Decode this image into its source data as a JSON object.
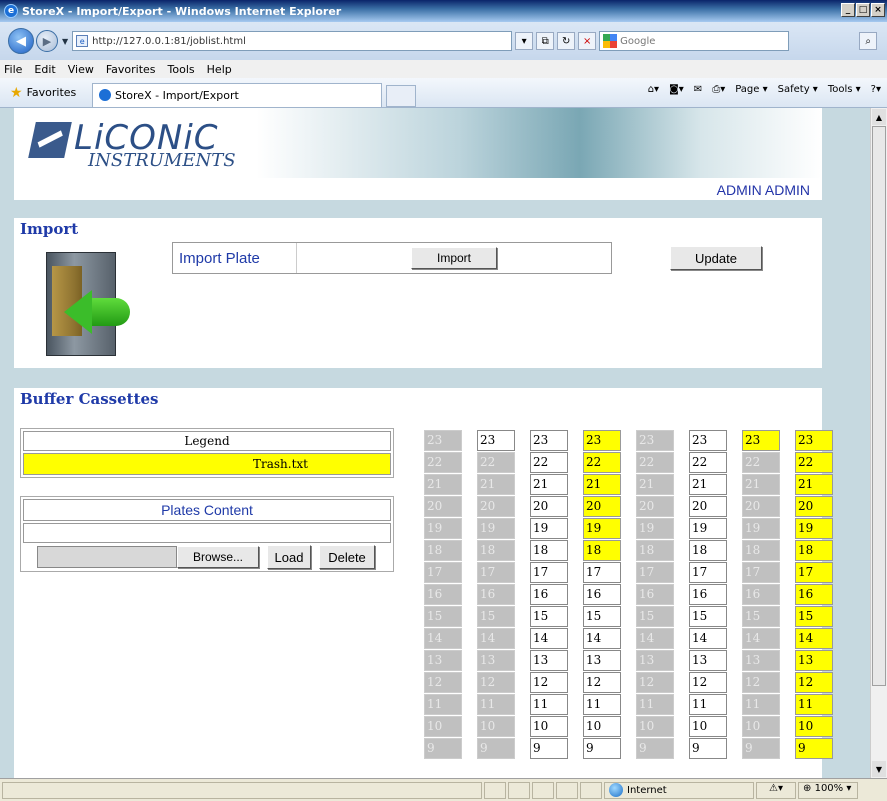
{
  "window": {
    "title": "StoreX - Import/Export - Windows Internet Explorer"
  },
  "address": {
    "url": "http://127.0.0.1:81/joblist.html",
    "search_placeholder": "Google"
  },
  "menu": [
    "File",
    "Edit",
    "View",
    "Favorites",
    "Tools",
    "Help"
  ],
  "favorites": {
    "label": "Favorites",
    "tab": "StoreX - Import/Export"
  },
  "command": {
    "page": "Page ▾",
    "safety": "Safety ▾",
    "tools": "Tools ▾"
  },
  "header": {
    "logo": "LiCONiC",
    "logo_sub": "INSTRUMENTS",
    "user": "ADMIN ADMIN"
  },
  "import": {
    "title": "Import",
    "label": "Import Plate",
    "import_button": "Import",
    "update_button": "Update"
  },
  "buffer": {
    "title": "Buffer Cassettes",
    "legend_title": "Legend",
    "legend_item": "Trash.txt",
    "plates_title": "Plates Content",
    "browse": "Browse...",
    "load": "Load",
    "delete": "Delete",
    "columns": [
      [
        "g",
        "g",
        "g",
        "g",
        "g",
        "g",
        "g",
        "g",
        "g",
        "g",
        "g",
        "g",
        "g",
        "g",
        "g"
      ],
      [
        "w",
        "g",
        "g",
        "g",
        "g",
        "g",
        "g",
        "g",
        "g",
        "g",
        "g",
        "g",
        "g",
        "g",
        "g"
      ],
      [
        "w",
        "w",
        "w",
        "w",
        "w",
        "w",
        "w",
        "w",
        "w",
        "w",
        "w",
        "w",
        "w",
        "w",
        "w"
      ],
      [
        "y",
        "y",
        "y",
        "y",
        "y",
        "y",
        "w",
        "w",
        "w",
        "w",
        "w",
        "w",
        "w",
        "w",
        "w"
      ],
      [
        "g",
        "g",
        "g",
        "g",
        "g",
        "g",
        "g",
        "g",
        "g",
        "g",
        "g",
        "g",
        "g",
        "g",
        "g"
      ],
      [
        "w",
        "w",
        "w",
        "w",
        "w",
        "w",
        "w",
        "w",
        "w",
        "w",
        "w",
        "w",
        "w",
        "w",
        "w"
      ],
      [
        "y",
        "g",
        "g",
        "g",
        "g",
        "g",
        "g",
        "g",
        "g",
        "g",
        "g",
        "g",
        "g",
        "g",
        "g"
      ],
      [
        "y",
        "y",
        "y",
        "y",
        "y",
        "y",
        "y",
        "y",
        "y",
        "y",
        "y",
        "y",
        "y",
        "y",
        "y"
      ]
    ],
    "numbers": [
      23,
      22,
      21,
      20,
      19,
      18,
      17,
      16,
      15,
      14,
      13,
      12,
      11,
      10,
      9
    ]
  },
  "status": {
    "zone": "Internet",
    "zoom": "100%"
  }
}
